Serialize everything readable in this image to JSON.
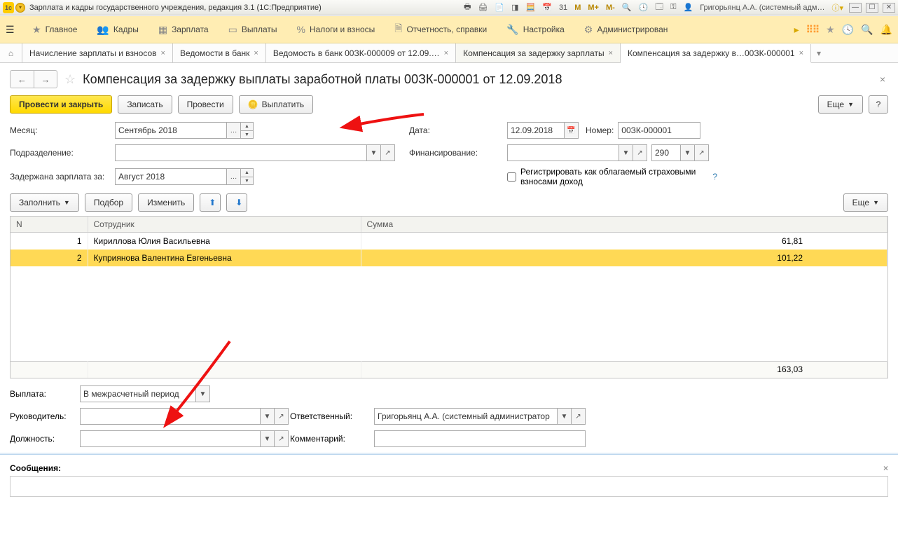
{
  "window": {
    "title": "Зарплата и кадры государственного учреждения, редакция 3.1  (1С:Предприятие)",
    "user": "Григорьянц А.А. (системный адм…"
  },
  "menu": {
    "items": [
      "Главное",
      "Кадры",
      "Зарплата",
      "Выплаты",
      "Налоги и взносы",
      "Отчетность, справки",
      "Настройка",
      "Администрирован"
    ]
  },
  "tabs": {
    "t1": "Начисление зарплаты и взносов",
    "t2": "Ведомости в банк",
    "t3": "Ведомость в банк 00ЗК-000009 от 12.09.…",
    "t4": "Компенсация за задержку зарплаты",
    "t5": "Компенсация за задержку в…00ЗК-000001"
  },
  "doc": {
    "title": "Компенсация за задержку выплаты заработной платы 00ЗК-000001 от 12.09.2018"
  },
  "toolbar": {
    "post_close": "Провести и закрыть",
    "save": "Записать",
    "post": "Провести",
    "pay": "Выплатить",
    "more": "Еще",
    "help": "?"
  },
  "form": {
    "month_label": "Месяц:",
    "month": "Сентябрь 2018",
    "subdiv_label": "Подразделение:",
    "delayed_label": "Задержана зарплата за:",
    "delayed": "Август 2018",
    "date_label": "Дата:",
    "date": "12.09.2018",
    "number_label": "Номер:",
    "number": "00ЗК-000001",
    "fin_label": "Финансирование:",
    "fin2": "290",
    "reg_label": "Регистрировать как облагаемый страховыми взносами доход"
  },
  "tbltoolbar": {
    "fill": "Заполнить",
    "pick": "Подбор",
    "edit": "Изменить",
    "more": "Еще"
  },
  "table": {
    "h_n": "N",
    "h_emp": "Сотрудник",
    "h_sum": "Сумма",
    "rows": [
      {
        "n": "1",
        "emp": "Кириллова Юлия Васильевна",
        "sum": "61,81"
      },
      {
        "n": "2",
        "emp": "Куприянова Валентина Евгеньевна",
        "sum": "101,22"
      }
    ],
    "total": "163,03"
  },
  "bottom": {
    "payout_label": "Выплата:",
    "payout": "В межрасчетный период",
    "head_label": "Руководитель:",
    "resp_label": "Ответственный:",
    "resp": "Григорьянц А.А. (системный администратор",
    "pos_label": "Должность:",
    "comment_label": "Комментарий:"
  },
  "messages": {
    "label": "Сообщения:"
  }
}
